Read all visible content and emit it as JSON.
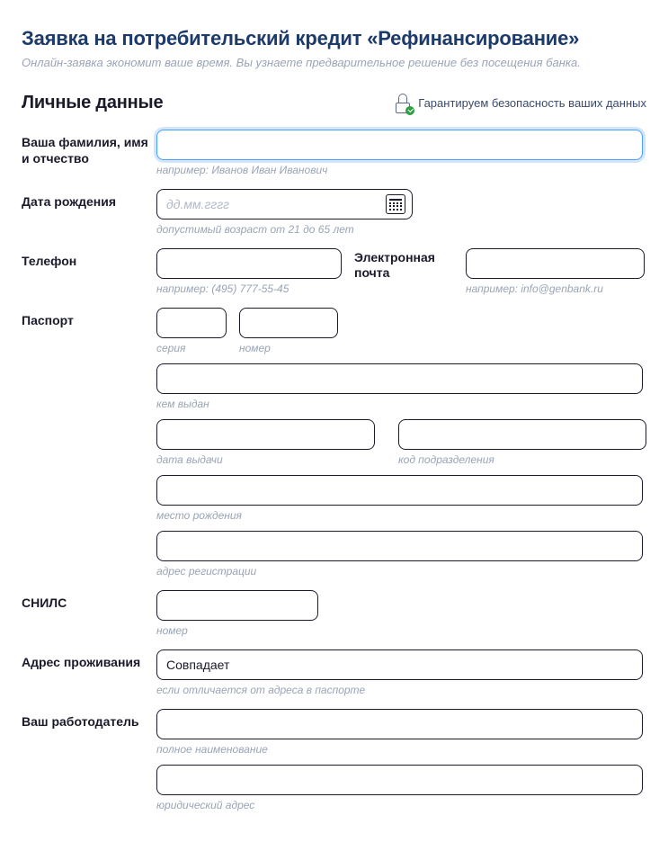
{
  "header": {
    "title": "Заявка на потребительский кредит «Рефинансирование»",
    "subtitle": "Онлайн-заявка экономит ваше время. Вы узнаете предварительное решение без посещения банка."
  },
  "section": {
    "title": "Личные данные",
    "security_note": "Гарантируем безопасность ваших данных"
  },
  "fields": {
    "fullname": {
      "label": "Ваша фамилия, имя и отчество",
      "hint": "например: Иванов Иван Иванович"
    },
    "birthdate": {
      "label": "Дата рождения",
      "placeholder": "дд.мм.гггг",
      "hint": "допустимый возраст от 21 до 65 лет"
    },
    "phone": {
      "label": "Телефон",
      "hint": "например: (495) 777-55-45"
    },
    "email": {
      "label": "Электронная почта",
      "hint": "например: info@genbank.ru"
    },
    "passport": {
      "label": "Паспорт",
      "series_hint": "серия",
      "number_hint": "номер",
      "issued_by_hint": "кем выдан",
      "issue_date_hint": "дата выдачи",
      "dept_code_hint": "код подразделения",
      "birthplace_hint": "место рождения",
      "reg_address_hint": "адрес регистрации"
    },
    "snils": {
      "label": "СНИЛС",
      "hint": "номер"
    },
    "residence": {
      "label": "Адрес проживания",
      "value": "Совпадает",
      "hint": "если отличается от адреса в паспорте"
    },
    "employer": {
      "label": "Ваш работодатель",
      "name_hint": "полное наименование",
      "address_hint": "юридический адрес"
    }
  }
}
